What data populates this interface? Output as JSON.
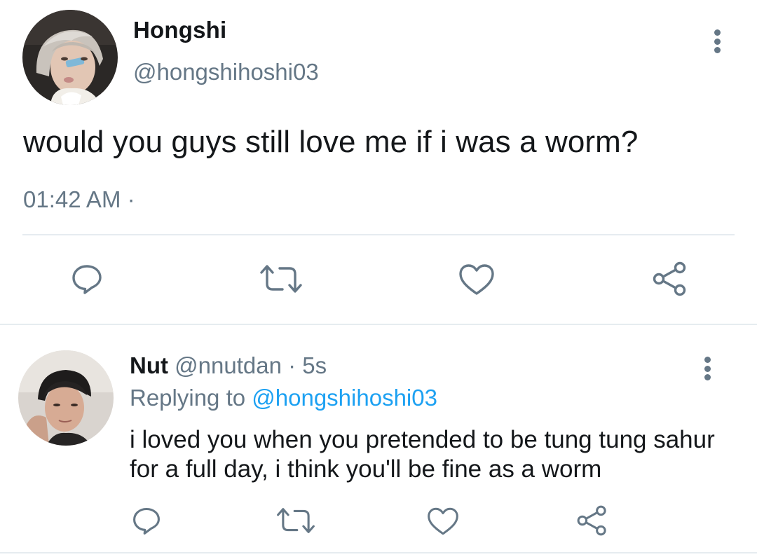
{
  "main_tweet": {
    "display_name": "Hongshi",
    "handle": "@hongshihoshi03",
    "text": "would you guys still love me if i was a worm?",
    "timestamp": "01:42 AM ·",
    "avatar": "profile-photo",
    "actions": [
      "reply-icon",
      "retweet-icon",
      "like-icon",
      "share-icon"
    ]
  },
  "reply": {
    "display_name": "Nut",
    "handle_time": " @nnutdan · 5s",
    "replying_prefix": "Replying to ",
    "replying_mention": "@hongshihoshi03",
    "text": "i loved you when you pretended to be tung tung sahur for a full day, i think you'll be fine as a worm",
    "avatar": "profile-photo",
    "actions": [
      "reply-icon",
      "retweet-icon",
      "like-icon",
      "share-icon"
    ]
  },
  "colors": {
    "primary_text": "#14171a",
    "secondary_text": "#657786",
    "link": "#1da1f2",
    "divider": "#e6ecf0"
  }
}
